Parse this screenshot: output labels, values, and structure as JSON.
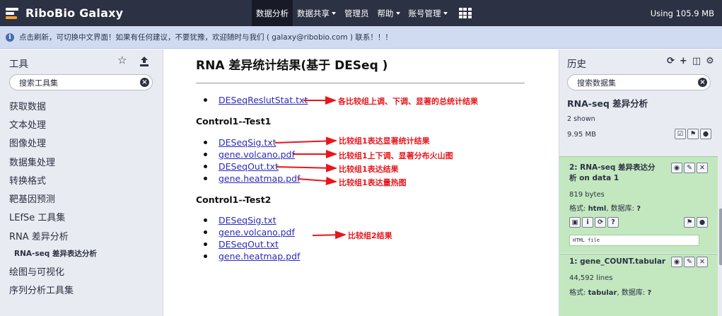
{
  "navbar": {
    "brand": "RiboBio Galaxy",
    "items": [
      {
        "label": "数据分析",
        "active": true,
        "caret": false
      },
      {
        "label": "数据共享",
        "active": false,
        "caret": true
      },
      {
        "label": "管理员",
        "active": false,
        "caret": false
      },
      {
        "label": "帮助",
        "active": false,
        "caret": true
      },
      {
        "label": "账号管理",
        "active": false,
        "caret": true
      }
    ],
    "usage": "Using 105.9 MB"
  },
  "banner": {
    "text": "点击刷新，可切换中文界面！如果有任何建议，不要犹豫，欢迎随时与我们 ( galaxy@ribobio.com ) 联系！！！"
  },
  "tools": {
    "title": "工具",
    "search_placeholder": "搜索工具集",
    "items": [
      {
        "label": "获取数据"
      },
      {
        "label": "文本处理"
      },
      {
        "label": "图像处理"
      },
      {
        "label": "数据集处理"
      },
      {
        "label": "转换格式"
      },
      {
        "label": "靶基因预测"
      },
      {
        "label": "LEfSe 工具集"
      },
      {
        "label": "RNA 差异分析"
      },
      {
        "label": "RNA-seq 差异表达分析",
        "sub": true
      },
      {
        "label": "绘图与可视化"
      },
      {
        "label": "序列分析工具集"
      }
    ]
  },
  "main": {
    "title": "RNA 差异统计结果(基于 DESeq )",
    "summary_file": "DESeqReslutStat.txt",
    "summary_note": "各比较组上调、下调、显著的总统计结果",
    "sections": [
      {
        "title": "Control1--Test1",
        "files": [
          "DESeqSig.txt",
          "gene.volcano.pdf",
          "DESeqOut.txt",
          "gene.heatmap.pdf"
        ],
        "notes": [
          "比较组1表达显著统计结果",
          "比较组1上下调、显著分布火山图",
          "比较组1表达结果",
          "比较组1表达量热图"
        ]
      },
      {
        "title": "Control1--Test2",
        "files": [
          "DESeqSig.txt",
          "gene.volcano.pdf",
          "DESeqOut.txt",
          "gene.heatmap.pdf"
        ],
        "note": "比较组2结果"
      }
    ]
  },
  "history": {
    "title": "历史",
    "search_placeholder": "搜索数据集",
    "name": "RNA-seq 差异分析",
    "shown": "2 shown",
    "size": "9.95 MB",
    "datasets": [
      {
        "title": "2: RNA-seq 差异表达分析 on data 1",
        "lines": "819 bytes",
        "format_label": "格式:",
        "format": "html",
        "db_label": "数据库:",
        "db": "?",
        "peek": "HTML file"
      },
      {
        "title": "1: gene_COUNT.tabular",
        "lines": "44,592 lines",
        "format_label": "格式:",
        "format": "tabular",
        "db_label": "数据库:",
        "db": "?"
      }
    ]
  },
  "colors": {
    "navbar": "#2c3143",
    "banner": "#d0dbf2",
    "panel": "#e8ebf1",
    "dataset_ok": "#c3e8c0",
    "link": "#2c2bb7",
    "annotation": "#e8161c"
  }
}
